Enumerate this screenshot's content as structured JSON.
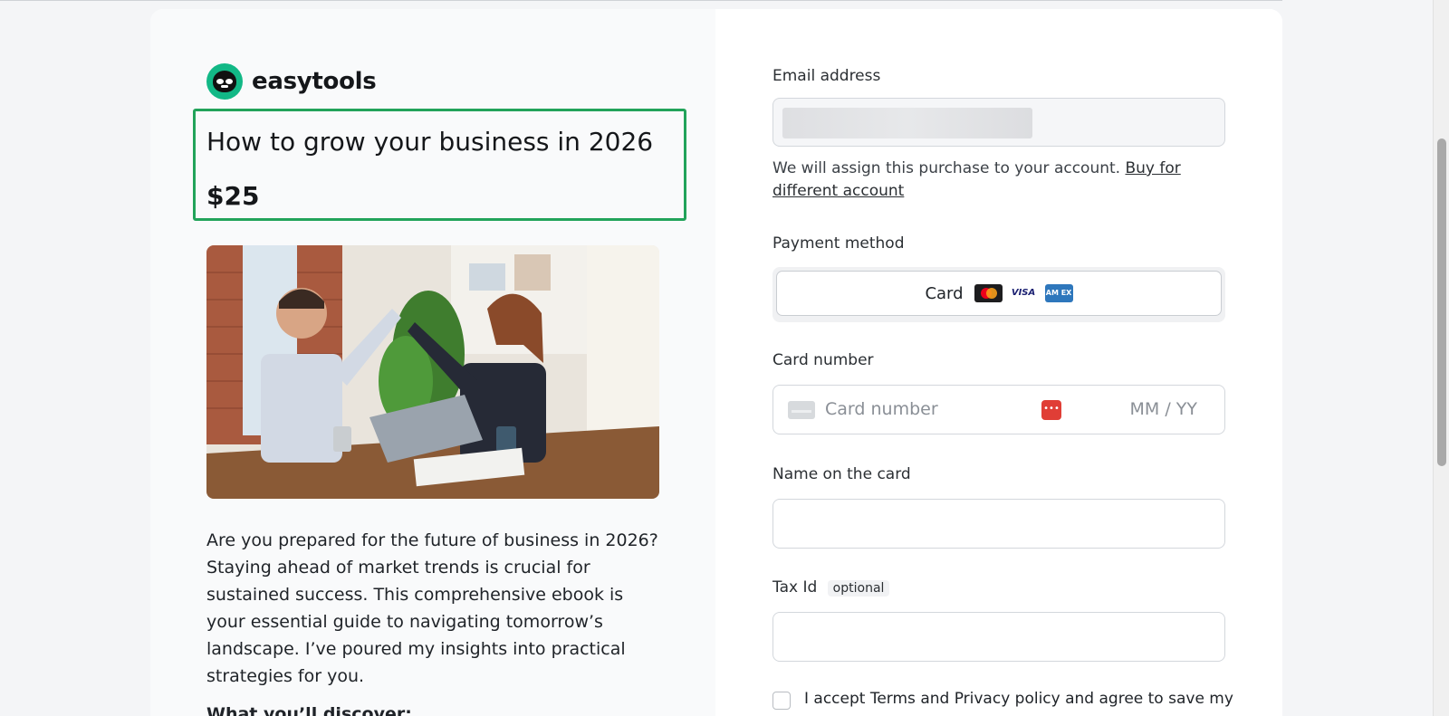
{
  "brand": {
    "name": "easytools",
    "accent": "#12b886"
  },
  "product": {
    "title": "How to grow your business in 2026",
    "price": "$25",
    "image_alt": "two business people high-fiving at a desk",
    "description": "Are you prepared for the future of business in 2026? Staying ahead of market trends is crucial for sustained success. This comprehensive ebook is your essential guide to navigating tomorrow’s landscape. I’ve poured my insights into practical strategies for you.",
    "discover_heading": "What you’ll discover:"
  },
  "form": {
    "email_label": "Email address",
    "account_hint": "We will assign this purchase to your account.",
    "buy_other_link": "Buy for different account",
    "payment_label": "Payment method",
    "payment_option": "Card",
    "card_brands": [
      "mastercard-icon",
      "visa-icon",
      "amex-icon"
    ],
    "amex_text": "AM EX",
    "visa_text": "VISA",
    "card_number_label": "Card number",
    "card_number_placeholder": "Card number",
    "expiry_placeholder": "MM / YY",
    "name_label": "Name on the card",
    "tax_label": "Tax Id",
    "tax_optional": "optional",
    "accept_text": "I accept Terms and Privacy policy and agree to save my"
  }
}
